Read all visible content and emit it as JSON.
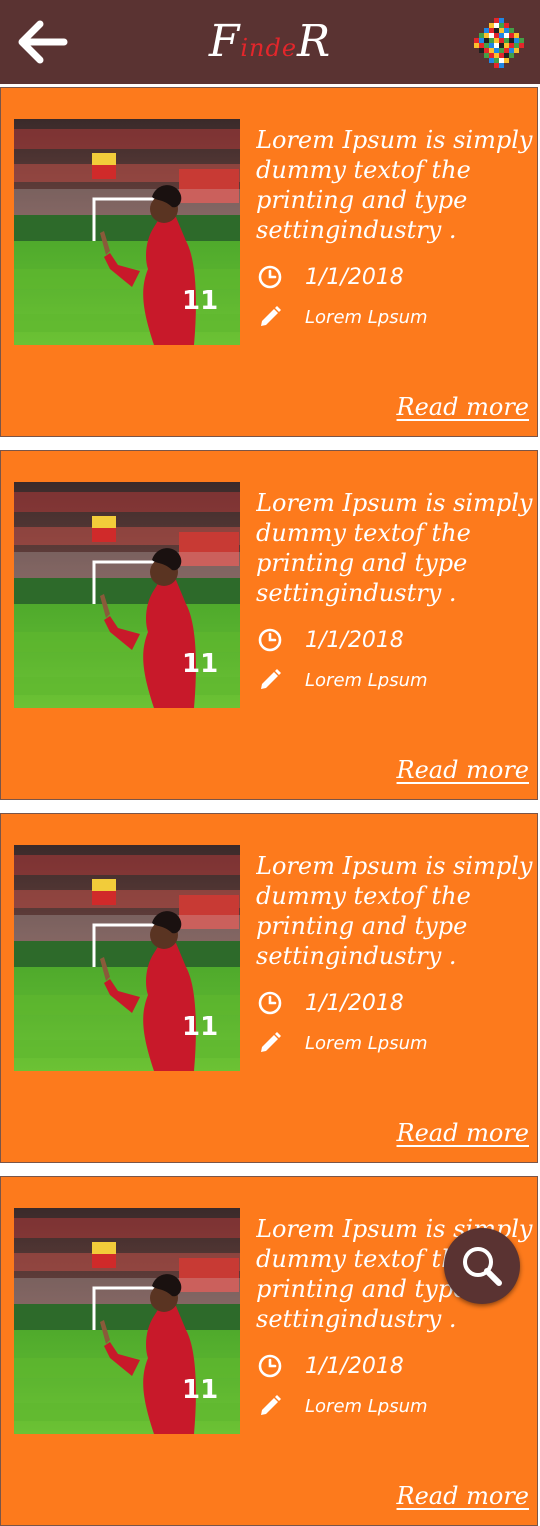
{
  "header": {
    "logo_part1": "F",
    "logo_part2": "inde",
    "logo_part3": "R",
    "back_icon": "arrow-left-icon",
    "brand_icon": "colorful-pixel-grid-icon"
  },
  "articles": [
    {
      "line1": "Lorem Ipsum is simply",
      "line2": "dummy textof the",
      "line3": "printing and type",
      "line4": "settingindustry .",
      "date": "1/1/2018",
      "author": "Lorem Lpsum",
      "read_more": "Read more"
    },
    {
      "line1": "Lorem Ipsum is simply",
      "line2": "dummy textof the",
      "line3": "printing and type",
      "line4": "settingindustry .",
      "date": "1/1/2018",
      "author": "Lorem Lpsum",
      "read_more": "Read more"
    },
    {
      "line1": "Lorem Ipsum is simply",
      "line2": "dummy textof the",
      "line3": "printing and type",
      "line4": "settingindustry .",
      "date": "1/1/2018",
      "author": "Lorem Lpsum",
      "read_more": "Read more"
    },
    {
      "line1": "Lorem Ipsum is simply",
      "line2": "dummy textof the",
      "line3": "printing and type",
      "line4": "settingindustry .",
      "date": "1/1/2018",
      "author": "Lorem Lpsum",
      "read_more": "Read more"
    }
  ],
  "fab": {
    "icon": "search-icon"
  },
  "colors": {
    "header": "#5a3332",
    "card": "#fd7a1c",
    "accent_red": "#e3262b"
  }
}
